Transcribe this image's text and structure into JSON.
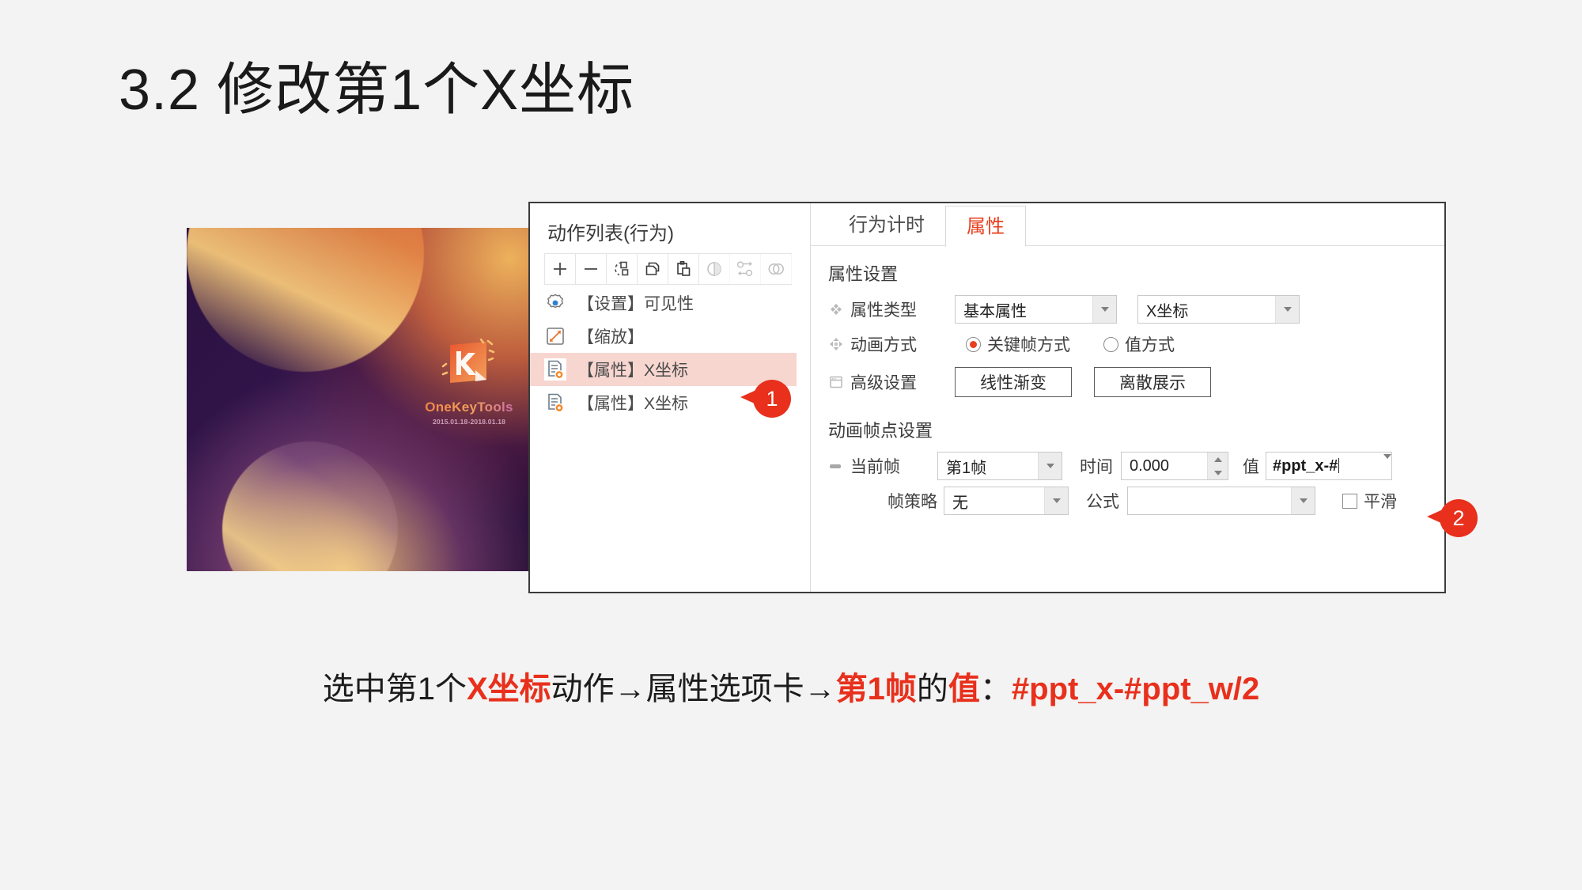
{
  "slide": {
    "title": "3.2 修改第1个X坐标",
    "accent_color": "#e8301c"
  },
  "promo_image": {
    "brand": "OneKeyTools",
    "dates": "2015.01.18-2018.01.18",
    "logo_letter": "K"
  },
  "dialog": {
    "action_list": {
      "title": "动作列表(行为)",
      "toolbar": [
        {
          "name": "add-icon",
          "enabled": true
        },
        {
          "name": "remove-icon",
          "enabled": true
        },
        {
          "name": "select-shape-icon",
          "enabled": true
        },
        {
          "name": "copy-icon",
          "enabled": true
        },
        {
          "name": "paste-icon",
          "enabled": true
        },
        {
          "name": "mirror-icon",
          "enabled": false
        },
        {
          "name": "swap-icon",
          "enabled": false
        },
        {
          "name": "merge-icon",
          "enabled": false
        }
      ],
      "items": [
        {
          "label": "【设置】可见性",
          "icon": "gear-icon",
          "selected": false
        },
        {
          "label": "【缩放】",
          "icon": "scale-icon",
          "selected": false
        },
        {
          "label": "【属性】X坐标",
          "icon": "property-icon",
          "selected": true
        },
        {
          "label": "【属性】X坐标",
          "icon": "property-icon",
          "selected": false
        }
      ]
    },
    "tabs": [
      {
        "label": "行为计时",
        "active": false
      },
      {
        "label": "属性",
        "active": true
      }
    ],
    "property_settings": {
      "section_title": "属性设置",
      "property_type": {
        "label": "属性类型",
        "icon": "diamond-icon",
        "category_value": "基本属性",
        "target_value": "X坐标"
      },
      "animation_mode": {
        "label": "动画方式",
        "icon": "move-icon",
        "options": [
          {
            "label": "关键帧方式",
            "selected": true
          },
          {
            "label": "值方式",
            "selected": false
          }
        ]
      },
      "advanced": {
        "label": "高级设置",
        "icon": "window-icon",
        "buttons": [
          "线性渐变",
          "离散展示"
        ]
      }
    },
    "keyframe_settings": {
      "section_title": "动画帧点设置",
      "current_frame": {
        "label": "当前帧",
        "icon": "frame-icon",
        "value": "第1帧"
      },
      "time": {
        "label": "时间",
        "value": "0.000"
      },
      "value": {
        "label": "值",
        "value": "#ppt_x-#"
      },
      "frame_strategy": {
        "label": "帧策略",
        "value": "无"
      },
      "formula": {
        "label": "公式",
        "value": ""
      },
      "smooth": {
        "label": "平滑",
        "checked": false
      }
    }
  },
  "callouts": [
    {
      "number": "1"
    },
    {
      "number": "2"
    }
  ],
  "caption": {
    "part1": "选中第1个",
    "hl1": "X坐标",
    "part2": "动作→属性选项卡→",
    "hl2": "第1帧",
    "part3": "的",
    "hl3": "值",
    "part4": "：",
    "hl4": "#ppt_x-#ppt_w/2"
  }
}
